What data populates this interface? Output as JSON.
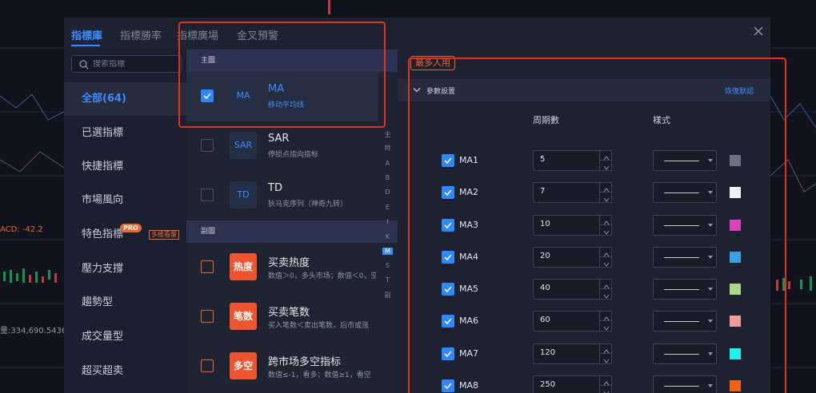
{
  "tabs": [
    "指標庫",
    "指標勝率",
    "指標廣場",
    "金叉預警"
  ],
  "search": {
    "placeholder": "搜索指標"
  },
  "categories": [
    "全部(64)",
    "已選指標",
    "快捷指標",
    "市場風向",
    "特色指標",
    "壓力支撐",
    "趨勢型",
    "成交量型",
    "超买超卖"
  ],
  "badges": {
    "pro": "PRO",
    "multi": "多維看盤"
  },
  "background": {
    "left_label_1": "ACD: -42.2",
    "left_label_2": "量:334,690.5436"
  },
  "sections": {
    "main": "主圖",
    "sub": "副圖"
  },
  "main_indicators": [
    {
      "icon_text": "MA",
      "title": "MA",
      "desc": "移动平均线",
      "checked": true
    },
    {
      "icon_text": "SAR",
      "title": "SAR",
      "desc": "停损点指向指标",
      "checked": false
    },
    {
      "icon_text": "TD",
      "title": "TD",
      "desc": "狄马克序列（神奇九转）",
      "checked": false
    }
  ],
  "sub_indicators": [
    {
      "icon_text": "热度",
      "title": "买卖热度",
      "desc": "数值＞0，多头市场；数值＜0，空头市场",
      "checked": false
    },
    {
      "icon_text": "笔数",
      "title": "买卖笔数",
      "desc": "买入笔数＜卖出笔数，后市或涨",
      "checked": false
    },
    {
      "icon_text": "多空",
      "title": "跨市场多空指标",
      "desc": "数值≤-1，看多；数值≥1，看空",
      "checked": false
    }
  ],
  "alpha_index": [
    "主",
    "特",
    "A",
    "B",
    "D",
    "E",
    "I",
    "K",
    "M",
    "S",
    "T",
    "副"
  ],
  "alpha_active": "M",
  "settings": {
    "most_used": "最多人用",
    "param_title": "參數設置",
    "reset": "恢復默認",
    "col_period": "周期數",
    "col_style": "樣式",
    "rows": [
      {
        "name": "MA1",
        "period": "5",
        "color": "#6d7188",
        "checked": true
      },
      {
        "name": "MA2",
        "period": "7",
        "color": "#f2f2f2",
        "checked": true
      },
      {
        "name": "MA3",
        "period": "10",
        "color": "#e040b8",
        "checked": true
      },
      {
        "name": "MA4",
        "period": "20",
        "color": "#3aa0e6",
        "checked": true
      },
      {
        "name": "MA5",
        "period": "40",
        "color": "#a8d880",
        "checked": true
      },
      {
        "name": "MA6",
        "period": "60",
        "color": "#f59b98",
        "checked": true
      },
      {
        "name": "MA7",
        "period": "120",
        "color": "#1ff2ee",
        "checked": true
      },
      {
        "name": "MA8",
        "period": "250",
        "color": "#ef6312",
        "checked": true
      }
    ]
  },
  "colors": {
    "accent": "#3b8bff",
    "highlight": "#e2311d",
    "orange": "#e8682f"
  }
}
